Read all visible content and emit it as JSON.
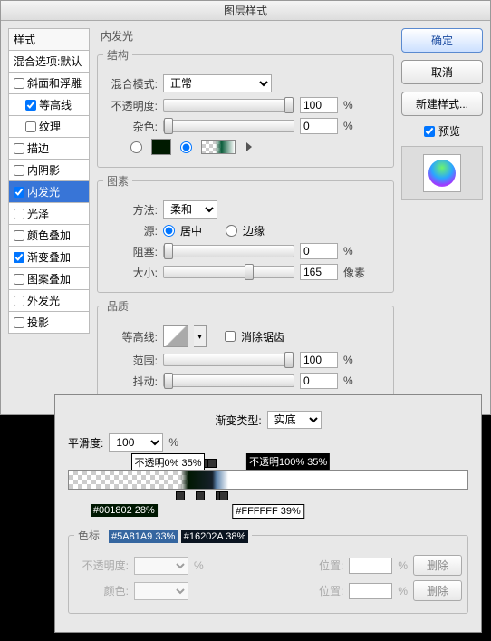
{
  "window": {
    "title": "图层样式"
  },
  "sidebar": {
    "styles_header": "样式",
    "blend_options": "混合选项:默认",
    "items": [
      {
        "label": "斜面和浮雕",
        "checked": false
      },
      {
        "label": "等高线",
        "checked": true,
        "sub": true
      },
      {
        "label": "纹理",
        "checked": false,
        "sub": true
      },
      {
        "label": "描边",
        "checked": false
      },
      {
        "label": "内阴影",
        "checked": false
      },
      {
        "label": "内发光",
        "checked": true,
        "active": true
      },
      {
        "label": "光泽",
        "checked": false
      },
      {
        "label": "颜色叠加",
        "checked": false
      },
      {
        "label": "渐变叠加",
        "checked": true
      },
      {
        "label": "图案叠加",
        "checked": false
      },
      {
        "label": "外发光",
        "checked": false
      },
      {
        "label": "投影",
        "checked": false
      }
    ]
  },
  "innerglow": {
    "section_title": "内发光",
    "structure": {
      "legend": "结构",
      "blend_mode_label": "混合模式:",
      "blend_mode_value": "正常",
      "opacity_label": "不透明度:",
      "opacity_value": "100",
      "opacity_unit": "%",
      "noise_label": "杂色:",
      "noise_value": "0",
      "noise_unit": "%",
      "color_hex": "#001802"
    },
    "elements": {
      "legend": "图素",
      "technique_label": "方法:",
      "technique_value": "柔和",
      "source_label": "源:",
      "source_center": "居中",
      "source_edge": "边缘",
      "source_selected": "center",
      "choke_label": "阻塞:",
      "choke_value": "0",
      "choke_unit": "%",
      "size_label": "大小:",
      "size_value": "165",
      "size_unit": "像素"
    },
    "quality": {
      "legend": "品质",
      "contour_label": "等高线:",
      "antialias_label": "消除锯齿",
      "antialias_checked": false,
      "range_label": "范围:",
      "range_value": "100",
      "range_unit": "%",
      "jitter_label": "抖动:",
      "jitter_value": "0",
      "jitter_unit": "%"
    }
  },
  "rightpane": {
    "ok": "确定",
    "cancel": "取消",
    "new_style": "新建样式...",
    "preview_label": "预览",
    "preview_checked": true
  },
  "gradeditor": {
    "grad_type_label": "渐变类型:",
    "grad_type_value": "实底",
    "smoothness_label": "平滑度:",
    "smoothness_value": "100",
    "smoothness_unit": "%",
    "opacity_stops": [
      {
        "pos": 35,
        "label": "不透明0% 35%",
        "style": "white"
      },
      {
        "pos": 35,
        "label": "不透明100% 35%",
        "style": "black",
        "offset": 90
      }
    ],
    "color_stops": [
      {
        "pos": 28,
        "label": "#001802 28%",
        "style": "green"
      },
      {
        "pos": 33,
        "label": "#5A81A9 33%",
        "style": "blue"
      },
      {
        "pos": 38,
        "label": "#16202A 38%",
        "style": "dark"
      },
      {
        "pos": 39,
        "label": "#FFFFFF 39%",
        "style": "white"
      }
    ],
    "stops_legend": "色标",
    "opacity_label": "不透明度:",
    "position_label": "位置:",
    "color_label": "颜色:",
    "delete_label": "删除",
    "opacity_value": "",
    "position_value": "",
    "unit": "%"
  }
}
